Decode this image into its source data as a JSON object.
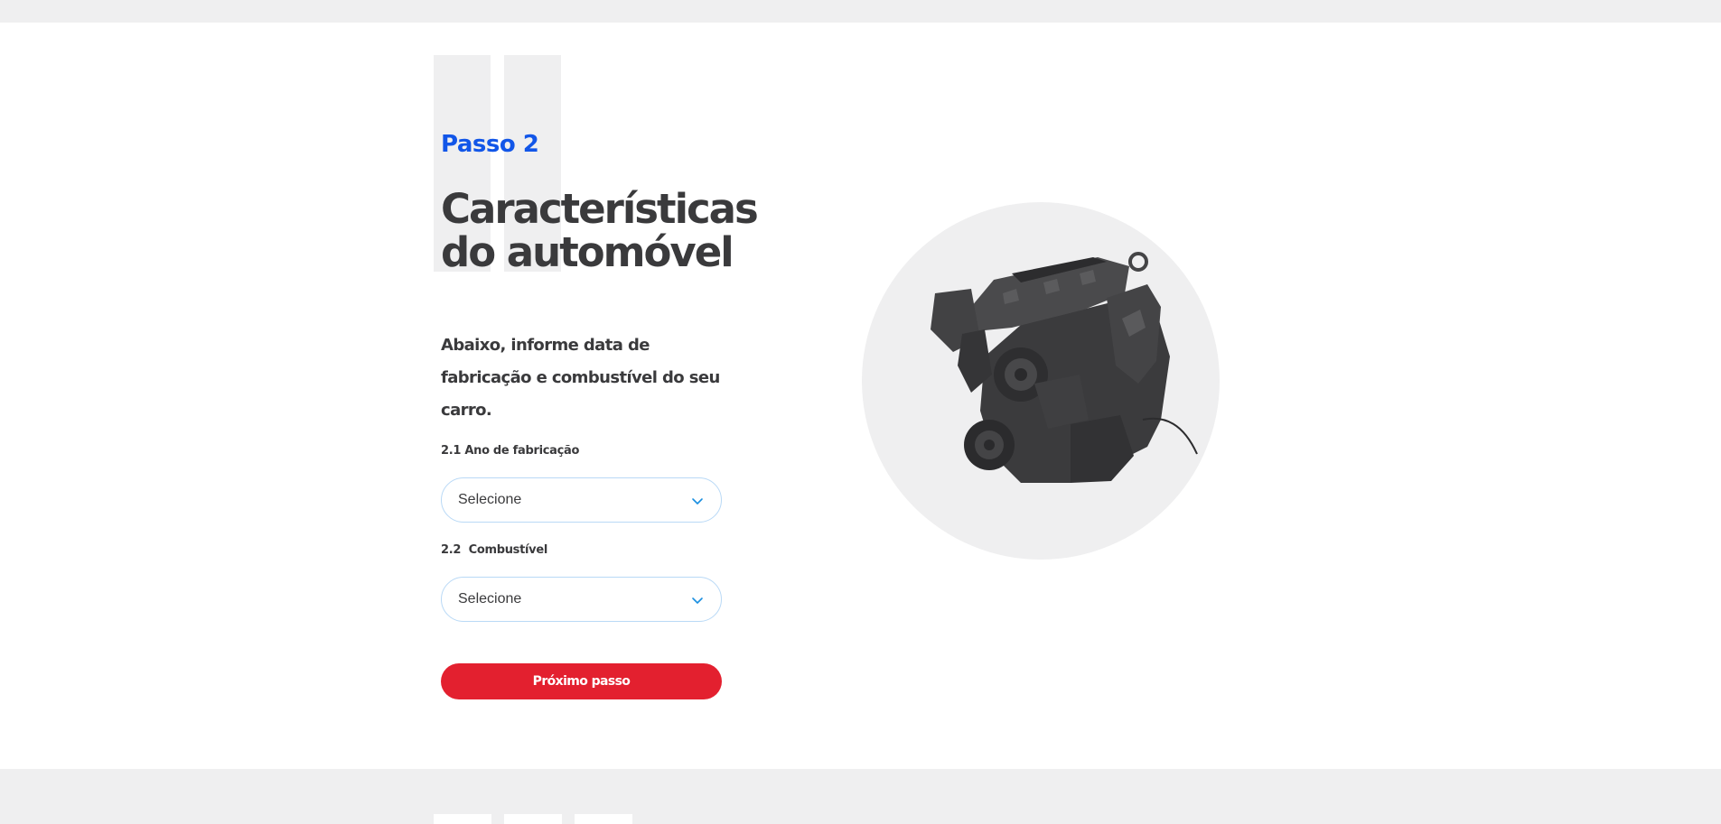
{
  "step": {
    "label": "Passo 2",
    "title": "Características do automóvel",
    "intro": "Abaixo, informe data de fabricação e combustível do seu carro."
  },
  "fields": [
    {
      "label": "2.1 Ano de fabricação",
      "value": "Selecione"
    },
    {
      "label": "2.2  Combustível",
      "value": "Selecione"
    }
  ],
  "actions": {
    "next_label": "Próximo passo"
  },
  "icons": {
    "select_chevron": "chevron-down-icon",
    "engine": "engine-image"
  },
  "colors": {
    "accent_blue": "#1256e8",
    "primary_red": "#e3202f",
    "text_dark": "#3a3a3c",
    "field_border": "#b9d9f6",
    "band_gray": "#efeff0"
  }
}
